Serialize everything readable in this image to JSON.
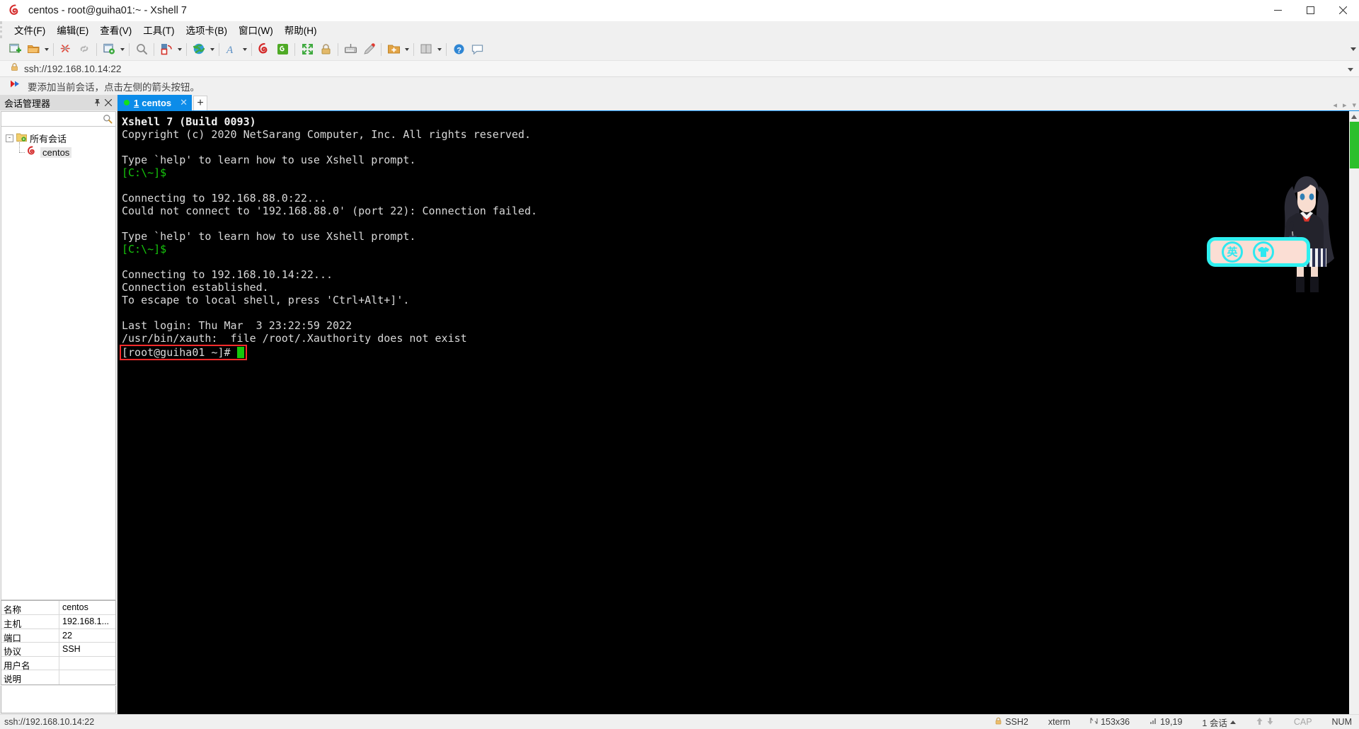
{
  "window": {
    "title": "centos - root@guiha01:~ - Xshell 7",
    "app_icon": "xshell-spiral-icon",
    "minimize_label": "─",
    "maximize_label": "☐",
    "close_label": "✕"
  },
  "menu": {
    "items": [
      {
        "label": "文件(F)",
        "name": "menu-file"
      },
      {
        "label": "编辑(E)",
        "name": "menu-edit"
      },
      {
        "label": "查看(V)",
        "name": "menu-view"
      },
      {
        "label": "工具(T)",
        "name": "menu-tools"
      },
      {
        "label": "选项卡(B)",
        "name": "menu-tabs"
      },
      {
        "label": "窗口(W)",
        "name": "menu-window"
      },
      {
        "label": "帮助(H)",
        "name": "menu-help"
      }
    ]
  },
  "toolbar": {
    "buttons": [
      {
        "name": "new-session-icon",
        "title": "新建会话"
      },
      {
        "name": "open-folder-icon",
        "title": "打开"
      },
      {
        "name": "reconnect-icon",
        "title": "重新连接"
      },
      {
        "name": "disconnect-icon",
        "title": "断开"
      },
      {
        "name": "session-properties-icon",
        "title": "属性"
      },
      {
        "name": "find-icon",
        "title": "查找"
      },
      {
        "name": "transfer-file-icon",
        "title": "文件传输"
      },
      {
        "name": "globe-icon",
        "title": "浏览"
      },
      {
        "name": "font-icon",
        "title": "字体"
      },
      {
        "name": "xshell-spiral-icon",
        "title": "Xshell"
      },
      {
        "name": "xftp-icon",
        "title": "Xftp"
      },
      {
        "name": "fullscreen-icon",
        "title": "全屏"
      },
      {
        "name": "lock-icon",
        "title": "锁定"
      },
      {
        "name": "keyboard-icon",
        "title": "键盘"
      },
      {
        "name": "highlighter-icon",
        "title": "高亮"
      },
      {
        "name": "add-folder-icon",
        "title": "添加"
      },
      {
        "name": "layout-icon",
        "title": "布局"
      },
      {
        "name": "help-icon",
        "title": "帮助"
      },
      {
        "name": "chat-icon",
        "title": "聊天"
      }
    ],
    "overflow_label": "▾"
  },
  "address_bar": {
    "icon": "lock-icon",
    "value": "ssh://192.168.10.14:22",
    "dropdown_label": "▾"
  },
  "notice_bar": {
    "icon": "red-arrow-icon",
    "text": "要添加当前会话，点击左侧的箭头按钮。"
  },
  "sidebar": {
    "header": {
      "title": "会话管理器",
      "pin_label": "⚐",
      "close_label": "✕"
    },
    "search": {
      "value": "",
      "placeholder": "",
      "icon": "search-icon"
    },
    "tree": {
      "root": {
        "label": "所有会话",
        "toggle": "-",
        "icon": "folder-sessions-icon"
      },
      "children": [
        {
          "label": "centos",
          "icon": "xshell-spiral-icon",
          "selected": true
        }
      ]
    },
    "properties": {
      "rows": [
        {
          "key": "名称",
          "value": "centos"
        },
        {
          "key": "主机",
          "value": "192.168.1..."
        },
        {
          "key": "端口",
          "value": "22"
        },
        {
          "key": "协议",
          "value": "SSH"
        },
        {
          "key": "用户名",
          "value": ""
        },
        {
          "key": "说明",
          "value": ""
        }
      ]
    }
  },
  "tabs": {
    "items": [
      {
        "number": "1",
        "label": "centos",
        "status": "connected",
        "close_label": "✕",
        "active": true
      }
    ],
    "new_tab_label": "+",
    "scroll_left_label": "◂",
    "scroll_right_label": "▸",
    "menu_label": "▾"
  },
  "terminal": {
    "lines": [
      {
        "text": "Xshell 7 (Build 0093)",
        "style": "bold"
      },
      {
        "text": "Copyright (c) 2020 NetSarang Computer, Inc. All rights reserved.",
        "style": "white"
      },
      {
        "text": "",
        "style": "white"
      },
      {
        "text": "Type `help' to learn how to use Xshell prompt.",
        "style": "white"
      },
      {
        "text": "[C:\\~]$",
        "style": "green"
      },
      {
        "text": "",
        "style": "white"
      },
      {
        "text": "Connecting to 192.168.88.0:22...",
        "style": "white"
      },
      {
        "text": "Could not connect to '192.168.88.0' (port 22): Connection failed.",
        "style": "white"
      },
      {
        "text": "",
        "style": "white"
      },
      {
        "text": "Type `help' to learn how to use Xshell prompt.",
        "style": "white"
      },
      {
        "text": "[C:\\~]$",
        "style": "green"
      },
      {
        "text": "",
        "style": "white"
      },
      {
        "text": "Connecting to 192.168.10.14:22...",
        "style": "white"
      },
      {
        "text": "Connection established.",
        "style": "white"
      },
      {
        "text": "To escape to local shell, press 'Ctrl+Alt+]'.",
        "style": "white"
      },
      {
        "text": "",
        "style": "white"
      },
      {
        "text": "Last login: Thu Mar  3 23:22:59 2022",
        "style": "white"
      },
      {
        "text": "/usr/bin/xauth:  file /root/.Xauthority does not exist",
        "style": "white"
      }
    ],
    "prompt": "[root@guiha01 ~]# ",
    "prompt_highlight_color": "#ff2b2b",
    "cursor_color": "#16c60c",
    "background": "#000000",
    "foreground": "#d9d9d9"
  },
  "overlay": {
    "name": "anime-input-method-indicator",
    "badge_chinese_glyph": "英",
    "badge_icon": "shirt-icon",
    "border_color": "#2ff0f0",
    "fill_color": "#fbded4"
  },
  "status_bar": {
    "left_text": "ssh://192.168.10.14:22",
    "protocol": "SSH2",
    "terminal_type": "xterm",
    "size": "153x36",
    "cursor_position": "19,19",
    "session_count": "1 会话",
    "caps": "CAP",
    "num": "NUM",
    "up_arrow": "↑",
    "down_arrow": "↓",
    "expander": "▲"
  }
}
